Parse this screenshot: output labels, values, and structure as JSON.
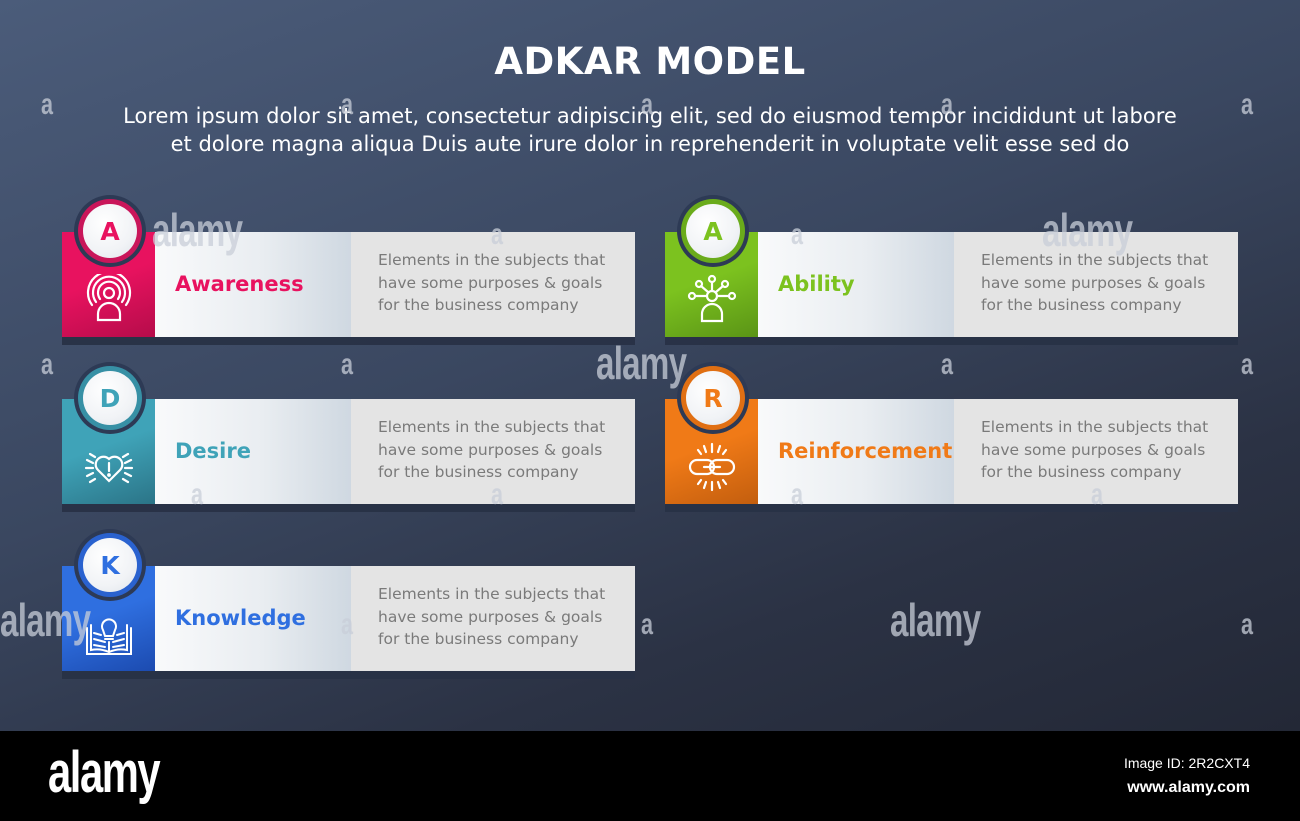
{
  "header": {
    "title": "ADKAR MODEL",
    "subtitle_line1": "Lorem ipsum dolor sit amet, consectetur adipiscing elit, sed do eiusmod tempor incididunt ut labore",
    "subtitle_line2": "et dolore magna aliqua Duis aute irure dolor in reprehenderit in voluptate velit esse sed do"
  },
  "steps": [
    {
      "letter": "A",
      "label": "Awareness",
      "icon": "broadcast-person-icon",
      "description": "Elements in the subjects that\nhave  some purposes & goals\nfor the  business company",
      "color": "#e8125f",
      "color_dark": "#b50c4a",
      "ring": "#c9165a"
    },
    {
      "letter": "A",
      "label": "Ability",
      "icon": "network-person-icon",
      "description": "Elements in the subjects that\nhave  some purposes & goals\nfor the  business company",
      "color": "#7cc21f",
      "color_dark": "#5a9416",
      "ring": "#6aab1b"
    },
    {
      "letter": "D",
      "label": "Desire",
      "icon": "heart-alert-icon",
      "description": "Elements in the subjects that\nhave  some purposes & goals\nfor the  business company",
      "color": "#3fa3b8",
      "color_dark": "#2b7487",
      "ring": "#3790a5"
    },
    {
      "letter": "R",
      "label": "Reinforcement",
      "icon": "chain-link-icon",
      "description": "Elements in the subjects that\nhave  some purposes & goals\nfor the  business company",
      "color": "#f07a17",
      "color_dark": "#c35e0e",
      "ring": "#e06f13"
    },
    {
      "letter": "K",
      "label": "Knowledge",
      "icon": "book-lightbulb-icon",
      "description": "Elements in the subjects that\nhave  some purposes & goals\nfor the  business company",
      "color": "#2f6fe0",
      "color_dark": "#1c4bb0",
      "ring": "#2a62cf"
    }
  ],
  "watermark": {
    "text": "alamy",
    "letter": "a"
  },
  "footer": {
    "logo": "alamy",
    "image_id": "Image ID: 2R2CXT4",
    "site": "www.alamy.com"
  }
}
